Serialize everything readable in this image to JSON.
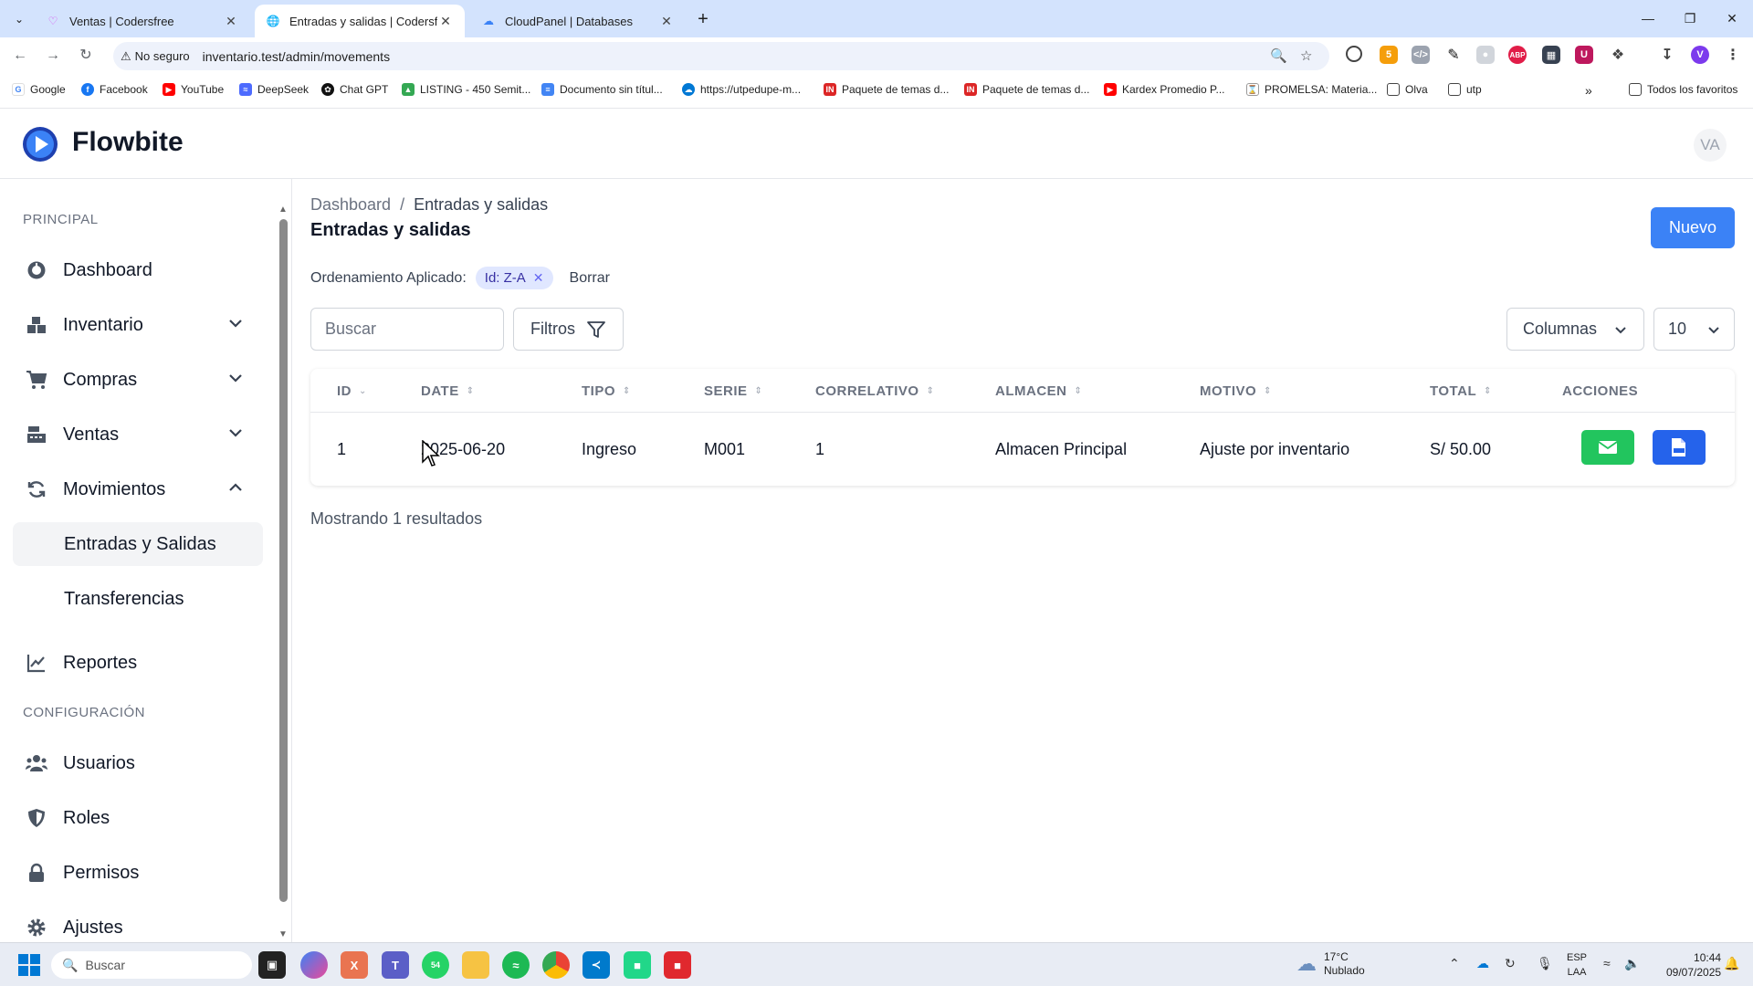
{
  "browser": {
    "tabs": [
      {
        "title": "Ventas | Codersfree",
        "active": false
      },
      {
        "title": "Entradas y salidas | Codersfree",
        "active": true
      },
      {
        "title": "CloudPanel | Databases",
        "active": false
      }
    ],
    "security_label": "No seguro",
    "url": "inventario.test/admin/movements",
    "profile_initial": "V",
    "bookmarks": [
      "Google",
      "Facebook",
      "YouTube",
      "DeepSeek",
      "Chat GPT",
      "LISTING - 450 Semit...",
      "Documento sin títul...",
      "https://utpedupe-m...",
      "Paquete de temas d...",
      "Paquete de temas d...",
      "Kardex Promedio P...",
      "PROMELSA: Materia...",
      "Olva",
      "utp"
    ],
    "all_bookmarks_label": "Todos los favoritos",
    "extension_badge": "5"
  },
  "app": {
    "brand": "Flowbite",
    "avatar_initials": "VA",
    "accent_color": "#3b82f6"
  },
  "sidebar": {
    "section_principal": "PRINCIPAL",
    "section_config": "CONFIGURACIÓN",
    "items": [
      {
        "label": "Dashboard",
        "icon": "dashboard-gauge-icon"
      },
      {
        "label": "Inventario",
        "icon": "warehouse-boxes-icon",
        "expandable": true,
        "expanded": false
      },
      {
        "label": "Compras",
        "icon": "shopping-cart-icon",
        "expandable": true,
        "expanded": false
      },
      {
        "label": "Ventas",
        "icon": "cash-register-icon",
        "expandable": true,
        "expanded": false
      },
      {
        "label": "Movimientos",
        "icon": "refresh-arrows-icon",
        "expandable": true,
        "expanded": true
      },
      {
        "label": "Reportes",
        "icon": "line-chart-icon"
      }
    ],
    "sub_items": [
      {
        "label": "Entradas y Salidas",
        "active": true
      },
      {
        "label": "Transferencias",
        "active": false
      }
    ],
    "config_items": [
      {
        "label": "Usuarios",
        "icon": "users-icon"
      },
      {
        "label": "Roles",
        "icon": "shield-icon"
      },
      {
        "label": "Permisos",
        "icon": "lock-icon"
      },
      {
        "label": "Ajustes",
        "icon": "gear-icon"
      }
    ]
  },
  "main": {
    "breadcrumb": {
      "link": "Dashboard",
      "separator": "/",
      "current": "Entradas y salidas"
    },
    "title": "Entradas y salidas",
    "new_button": "Nuevo",
    "sorting": {
      "label": "Ordenamiento Aplicado:",
      "chip": "Id: Z-A",
      "clear": "Borrar"
    },
    "search_placeholder": "Buscar",
    "filters_label": "Filtros",
    "columns_label": "Columnas",
    "per_page": "10",
    "table": {
      "headers": [
        "ID",
        "DATE",
        "TIPO",
        "SERIE",
        "CORRELATIVO",
        "ALMACEN",
        "MOTIVO",
        "TOTAL",
        "ACCIONES"
      ],
      "rows": [
        {
          "id": "1",
          "date": "2025-06-20",
          "tipo": "Ingreso",
          "serie": "M001",
          "correlativo": "1",
          "almacen": "Almacen Principal",
          "motivo": "Ajuste por inventario",
          "total": "S/ 50.00"
        }
      ]
    },
    "results_text": "Mostrando 1 resultados"
  },
  "taskbar": {
    "search_placeholder": "Buscar",
    "weather_temp": "17°C",
    "weather_desc": "Nublado",
    "lang_top": "ESP",
    "lang_bottom": "LAA",
    "time": "10:44",
    "date": "09/07/2025",
    "whatsapp_badge": "54"
  }
}
